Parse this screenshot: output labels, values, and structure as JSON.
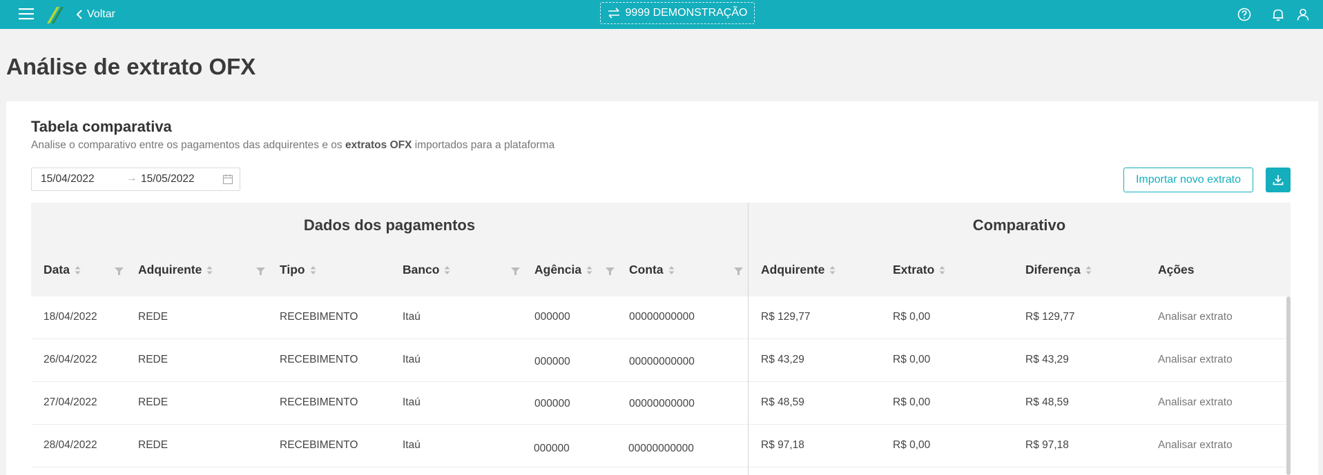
{
  "topbar": {
    "back_label": "Voltar",
    "company": "9999 DEMONSTRAÇÃO",
    "icons": [
      "menu-icon",
      "logo",
      "chevron-left-icon",
      "swap-icon",
      "help-icon",
      "bell-icon",
      "user-icon"
    ],
    "colors": {
      "primary": "#14aebc"
    }
  },
  "page": {
    "title": "Análise de extrato OFX"
  },
  "section": {
    "title": "Tabela comparativa",
    "desc_before": "Analise o comparativo entre os pagamentos das adquirentes e os ",
    "desc_bold": "extratos OFX",
    "desc_after": " importados para a plataforma"
  },
  "date_range": {
    "start": "15/04/2022",
    "end": "15/05/2022"
  },
  "buttons": {
    "import": "Importar novo extrato"
  },
  "table": {
    "groups": {
      "payments": "Dados dos pagamentos",
      "comparative": "Comparativo"
    },
    "columns": {
      "data": "Data",
      "adquirente": "Adquirente",
      "tipo": "Tipo",
      "banco": "Banco",
      "agencia": "Agência",
      "conta": "Conta",
      "c_adquirente": "Adquirente",
      "extrato": "Extrato",
      "diferenca": "Diferença",
      "acoes": "Ações"
    },
    "rows": [
      {
        "data": "18/04/2022",
        "adquirente": "REDE",
        "tipo": "RECEBIMENTO",
        "banco": "Itaú",
        "agencia": "000000",
        "conta": "00000000000",
        "c_adquirente": "R$ 129,77",
        "extrato": "R$ 0,00",
        "diferenca": "R$ 129,77",
        "acao": "Analisar extrato"
      },
      {
        "data": "26/04/2022",
        "adquirente": "REDE",
        "tipo": "RECEBIMENTO",
        "banco": "Itaú",
        "agencia": "000000",
        "conta": "00000000000",
        "c_adquirente": "R$ 43,29",
        "extrato": "R$ 0,00",
        "diferenca": "R$ 43,29",
        "acao": "Analisar extrato"
      },
      {
        "data": "27/04/2022",
        "adquirente": "REDE",
        "tipo": "RECEBIMENTO",
        "banco": "Itaú",
        "agencia": "000000",
        "conta": "00000000000",
        "c_adquirente": "R$ 48,59",
        "extrato": "R$ 0,00",
        "diferenca": "R$ 48,59",
        "acao": "Analisar extrato"
      },
      {
        "data": "28/04/2022",
        "adquirente": "REDE",
        "tipo": "RECEBIMENTO",
        "banco": "Itaú",
        "agencia": "000000",
        "conta": "00000000000",
        "c_adquirente": "R$ 97,18",
        "extrato": "R$ 0,00",
        "diferenca": "R$ 97,18",
        "acao": "Analisar extrato"
      }
    ]
  }
}
